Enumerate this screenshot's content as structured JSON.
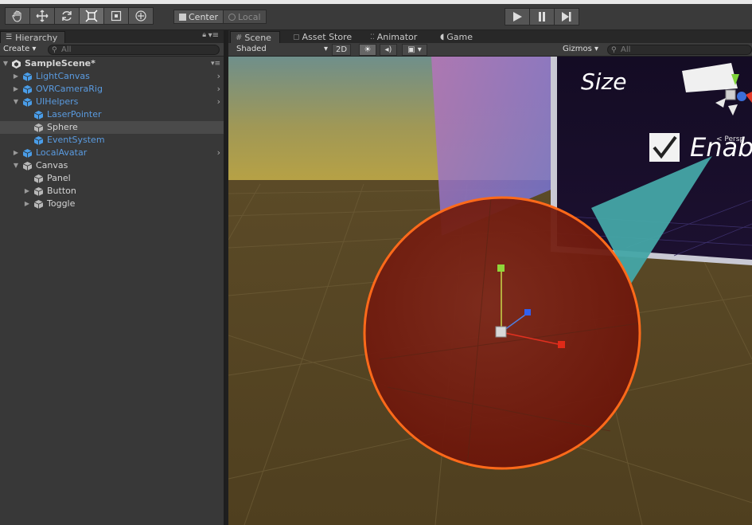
{
  "toolbar": {
    "tools": [
      "hand-tool",
      "move-tool",
      "rotate-tool",
      "scale-tool",
      "rect-tool",
      "transform-tool"
    ],
    "pivot_center": "Center",
    "pivot_local": "Local"
  },
  "hierarchy": {
    "tab": "Hierarchy",
    "create": "Create",
    "search_placeholder": "All",
    "scene_name": "SampleScene*",
    "items": [
      {
        "label": "LightCanvas",
        "depth": 1,
        "prefab": true,
        "expandable": true,
        "expanded": false,
        "chevron": true
      },
      {
        "label": "OVRCameraRig",
        "depth": 1,
        "prefab": true,
        "expandable": true,
        "expanded": false,
        "chevron": true
      },
      {
        "label": "UIHelpers",
        "depth": 1,
        "prefab": true,
        "expandable": true,
        "expanded": true,
        "chevron": true
      },
      {
        "label": "LaserPointer",
        "depth": 2,
        "prefab": true,
        "expandable": false
      },
      {
        "label": "Sphere",
        "depth": 2,
        "prefab": false,
        "expandable": false,
        "selected": true
      },
      {
        "label": "EventSystem",
        "depth": 2,
        "prefab": true,
        "expandable": false
      },
      {
        "label": "LocalAvatar",
        "depth": 1,
        "prefab": true,
        "expandable": true,
        "expanded": false,
        "chevron": true
      },
      {
        "label": "Canvas",
        "depth": 1,
        "prefab": false,
        "expandable": true,
        "expanded": true
      },
      {
        "label": "Panel",
        "depth": 2,
        "prefab": false,
        "expandable": false
      },
      {
        "label": "Button",
        "depth": 2,
        "prefab": false,
        "expandable": true,
        "expanded": false
      },
      {
        "label": "Toggle",
        "depth": 2,
        "prefab": false,
        "expandable": true,
        "expanded": false
      }
    ]
  },
  "scene": {
    "tabs": [
      {
        "label": "Scene",
        "active": true
      },
      {
        "label": "Asset Store",
        "active": false
      },
      {
        "label": "Animator",
        "active": false
      },
      {
        "label": "Game",
        "active": false
      }
    ],
    "shading_mode": "Shaded",
    "mode_2d": "2D",
    "gizmos": "Gizmos",
    "search_placeholder": "All",
    "canvas_text_size": "Size",
    "canvas_text_enable": "Enab",
    "persp_label": "Persp"
  },
  "colors": {
    "sphere": "#7a1d10",
    "sphere_outline": "#ff6a1a",
    "ground": "#4f3f1f",
    "prefab_blue": "#5a9be0"
  }
}
